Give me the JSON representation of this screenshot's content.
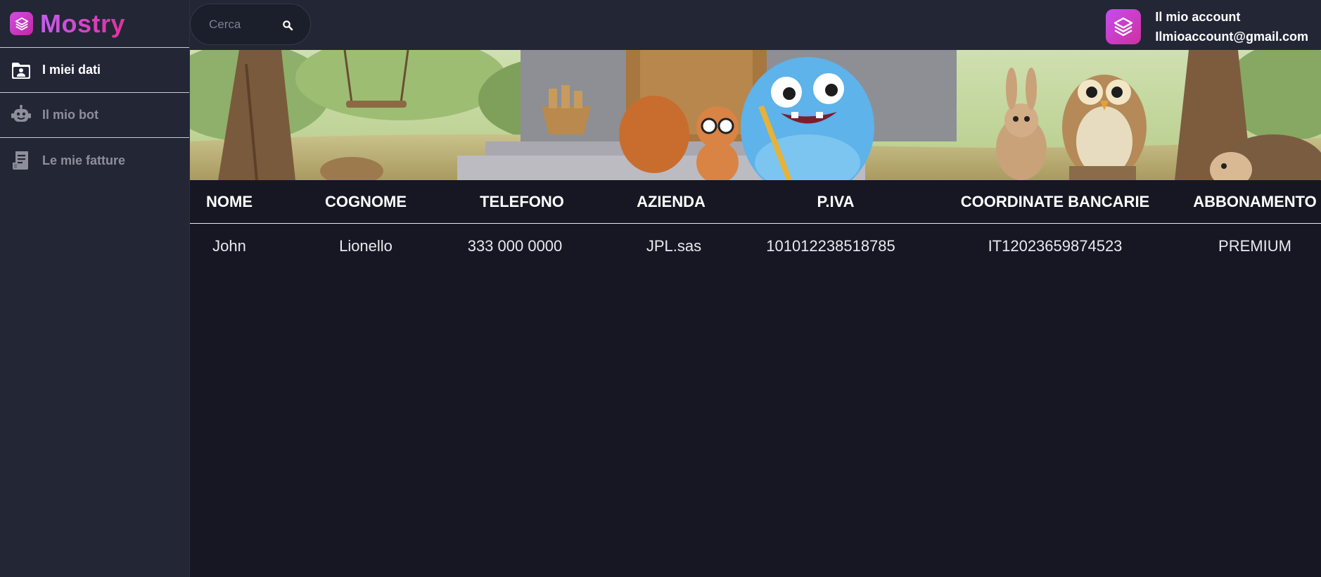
{
  "brand": {
    "name": "Mostry",
    "logo_icon": "layers-icon"
  },
  "sidebar": {
    "items": [
      {
        "label": "I miei dati",
        "icon": "folder-user-icon",
        "active": true
      },
      {
        "label": "Il  mio bot",
        "icon": "robot-icon",
        "active": false
      },
      {
        "label": "Le mie fatture",
        "icon": "invoice-icon",
        "active": false
      }
    ]
  },
  "search": {
    "placeholder": "Cerca",
    "value": ""
  },
  "account": {
    "title": "Il mio account",
    "email": "Ilmioaccount@gmail.com",
    "avatar_icon": "layers-icon"
  },
  "table": {
    "headers": [
      "NOME",
      "COGNOME",
      "TELEFONO",
      "AZIENDA",
      "P.IVA",
      "COORDINATE BANCARIE",
      "ABBONAMENTO"
    ],
    "rows": [
      [
        "John",
        "Lionello",
        "333 000 0000",
        "JPL.sas",
        "101012238518785",
        "IT12023659874523",
        "PREMIUM"
      ]
    ]
  },
  "colors": {
    "background": "#161722",
    "sidebar": "#222635",
    "accent_start": "#c55cf0",
    "accent_end": "#e2309b"
  }
}
